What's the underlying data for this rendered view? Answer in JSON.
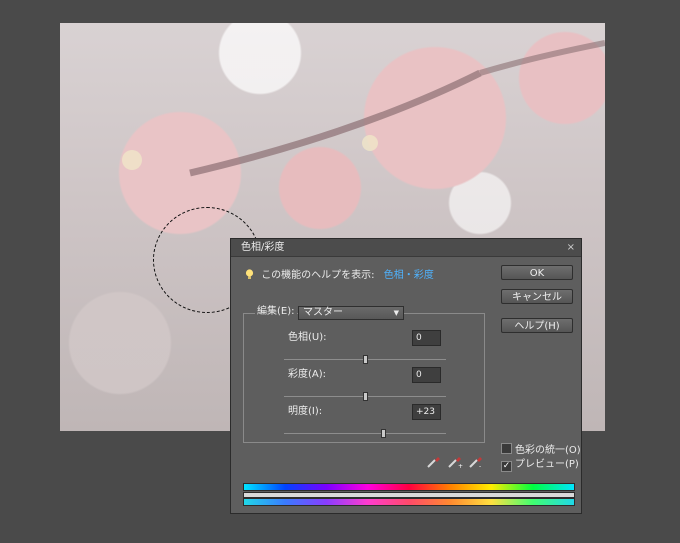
{
  "dialog": {
    "title": "色相/彩度",
    "close_glyph": "×",
    "help_prefix": "この機能のヘルプを表示:",
    "help_link": "色相・彩度",
    "buttons": {
      "ok": "OK",
      "cancel": "キャンセル",
      "help": "ヘルプ(H)"
    },
    "edit": {
      "label": "編集(E):",
      "selected": "マスター"
    },
    "params": [
      {
        "label": "色相(U):",
        "value": "0"
      },
      {
        "label": "彩度(A):",
        "value": "0"
      },
      {
        "label": "明度(I):",
        "value": "+23"
      }
    ],
    "slider_levels": [
      0.5,
      0.5,
      0.615
    ],
    "checks": {
      "colorize": {
        "label": "色彩の統一(O)",
        "checked": false
      },
      "preview": {
        "label": "プレビュー(P)",
        "checked": true
      }
    },
    "check_mark": "✓"
  },
  "icons": [
    "lightbulb-icon",
    "eyedropper-icon",
    "eyedropper-plus-icon",
    "eyedropper-minus-icon",
    "close-icon",
    "dropdown-arrow-icon"
  ],
  "colors": {
    "help_link": "#4fb3ff",
    "dialog_bg": "#5e5e5e",
    "workspace_bg": "#4a4a4a"
  }
}
